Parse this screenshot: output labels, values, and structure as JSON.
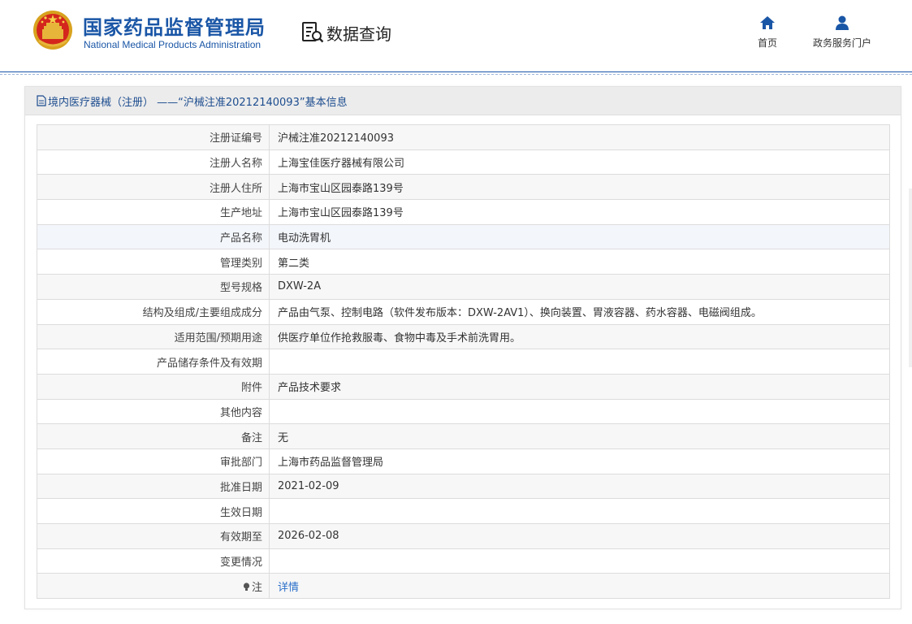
{
  "header": {
    "org_name_cn": "国家药品监督管理局",
    "org_name_en": "National Medical Products Administration",
    "section_title": "数据查询",
    "nav": [
      {
        "label": "首页",
        "icon": "home-icon"
      },
      {
        "label": "政务服务门户",
        "icon": "user-icon"
      }
    ]
  },
  "panel": {
    "title": "境内医疗器械（注册） ——“沪械注准20212140093”基本信息",
    "rows": [
      {
        "label": "注册证编号",
        "value": "沪械注准20212140093"
      },
      {
        "label": "注册人名称",
        "value": "上海宝佳医疗器械有限公司"
      },
      {
        "label": "注册人住所",
        "value": "上海市宝山区园泰路139号"
      },
      {
        "label": "生产地址",
        "value": "上海市宝山区园泰路139号"
      },
      {
        "label": "产品名称",
        "value": "电动洗胃机"
      },
      {
        "label": "管理类别",
        "value": "第二类"
      },
      {
        "label": "型号规格",
        "value": "DXW-2A"
      },
      {
        "label": "结构及组成/主要组成成分",
        "value": "产品由气泵、控制电路（软件发布版本：DXW-2AV1）、换向装置、胃液容器、药水容器、电磁阀组成。"
      },
      {
        "label": "适用范围/预期用途",
        "value": "供医疗单位作抢救服毒、食物中毒及手术前洗胃用。"
      },
      {
        "label": "产品储存条件及有效期",
        "value": ""
      },
      {
        "label": "附件",
        "value": "产品技术要求"
      },
      {
        "label": "其他内容",
        "value": ""
      },
      {
        "label": "备注",
        "value": "无"
      },
      {
        "label": "审批部门",
        "value": "上海市药品监督管理局"
      },
      {
        "label": "批准日期",
        "value": "2021-02-09"
      },
      {
        "label": "生效日期",
        "value": ""
      },
      {
        "label": "有效期至",
        "value": "2026-02-08"
      },
      {
        "label": "变更情况",
        "value": ""
      },
      {
        "label": "注",
        "value": "详情"
      }
    ]
  },
  "colors": {
    "brand_blue": "#1a56a6",
    "link_blue": "#2a6fc9",
    "title_blue": "#1d4d8f"
  }
}
